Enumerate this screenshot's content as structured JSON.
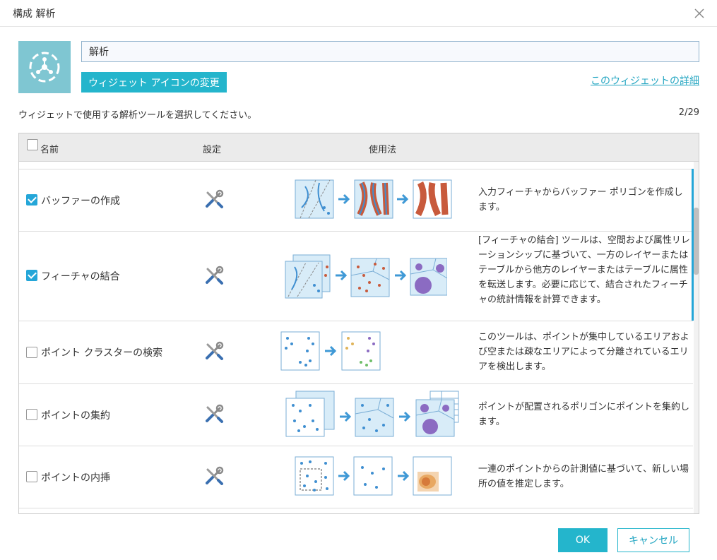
{
  "dialog": {
    "title": "構成 解析",
    "close_icon": "close-icon"
  },
  "widget": {
    "icon": "analysis-network-icon",
    "name_value": "解析",
    "change_icon_label": "ウィジェット アイコンの変更",
    "details_link": "このウィジェットの詳細"
  },
  "instruction": "ウィジェットで使用する解析ツールを選択してください。",
  "selected_count": "2/29",
  "table": {
    "headers": {
      "name": "名前",
      "settings": "設定",
      "usage": "使用法"
    },
    "rows": [
      {
        "label": "バッファーの作成",
        "checked": true,
        "settings_icon": "tools-icon",
        "description": "入力フィーチャからバッファー ポリゴンを作成します。"
      },
      {
        "label": "フィーチャの結合",
        "checked": true,
        "settings_icon": "tools-icon",
        "description": "[フィーチャの結合] ツールは、空間および属性リレーションシップに基づいて、一方のレイヤーまたはテーブルから他方のレイヤーまたはテーブルに属性を転送します。必要に応じて、結合されたフィーチャの統計情報を計算できます。"
      },
      {
        "label": "ポイント クラスターの検索",
        "checked": false,
        "settings_icon": "tools-icon",
        "description": "このツールは、ポイントが集中しているエリアおよび空または疎なエリアによって分離されているエリアを検出します。"
      },
      {
        "label": "ポイントの集約",
        "checked": false,
        "settings_icon": "tools-icon",
        "description": "ポイントが配置されるポリゴンにポイントを集約します。"
      },
      {
        "label": "ポイントの内挿",
        "checked": false,
        "settings_icon": "tools-icon",
        "description": "一連のポイントからの計測値に基づいて、新しい場所の値を推定します。"
      }
    ]
  },
  "footer": {
    "ok_label": "OK",
    "cancel_label": "キャンセル"
  },
  "colors": {
    "accent": "#24b5cc",
    "check": "#24a6d8",
    "map_fill": "#d8ecf8",
    "point": "#3f8fd1",
    "buffer": "#c85a3c",
    "arrow": "#3f99d6"
  }
}
